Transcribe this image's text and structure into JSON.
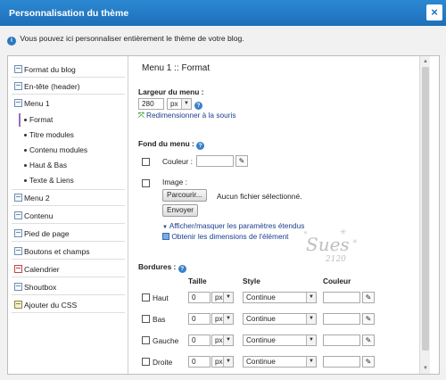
{
  "dialog": {
    "title": "Personnalisation du thème",
    "close_glyph": "×"
  },
  "info": {
    "icon": "info-icon",
    "text": "Vous pouvez ici personnaliser entièrement le thème de votre blog."
  },
  "sidebar": {
    "items": [
      {
        "label": "Format du blog",
        "icon": "page-icon"
      },
      {
        "label": "En-tête (header)",
        "icon": "page-icon"
      },
      {
        "label": "Menu 1",
        "icon": "page-icon"
      },
      {
        "label": "Menu 2",
        "icon": "page-icon"
      },
      {
        "label": "Contenu",
        "icon": "page-icon"
      },
      {
        "label": "Pied de page",
        "icon": "page-icon"
      },
      {
        "label": "Boutons et champs",
        "icon": "button-icon"
      },
      {
        "label": "Calendrier",
        "icon": "calendar-icon"
      },
      {
        "label": "Shoutbox",
        "icon": "chat-icon"
      },
      {
        "label": "Ajouter du CSS",
        "icon": "css-icon"
      }
    ],
    "subitems": [
      {
        "label": "Format",
        "active": true
      },
      {
        "label": "Titre modules"
      },
      {
        "label": "Contenu modules"
      },
      {
        "label": "Haut & Bas"
      },
      {
        "label": "Texte & Liens"
      }
    ]
  },
  "panel": {
    "heading": "Menu 1 :: Format",
    "width_label": "Largeur du menu :",
    "width_value": "280",
    "width_unit": "px",
    "resize_link": "Redimensionner à la souris",
    "fond_label": "Fond du menu :",
    "color_label": "Couleur :",
    "color_value": "",
    "image_label": "Image :",
    "browse_button": "Parcourir...",
    "no_file_text": "Aucun fichier sélectionné.",
    "send_button": "Envoyer",
    "toggle_params_link": "Afficher/masquer les paramètres étendus",
    "dimensions_link": "Obtenir les dimensions de l'élément",
    "borders_label": "Bordures :",
    "borders_columns": {
      "size": "Taille",
      "style": "Style",
      "color": "Couleur"
    },
    "borders": [
      {
        "label": "Haut",
        "size": "0",
        "unit": "px",
        "style": "Continue",
        "color": ""
      },
      {
        "label": "Bas",
        "size": "0",
        "unit": "px",
        "style": "Continue",
        "color": ""
      },
      {
        "label": "Gauche",
        "size": "0",
        "unit": "px",
        "style": "Continue",
        "color": ""
      },
      {
        "label": "Droite",
        "size": "0",
        "unit": "px",
        "style": "Continue",
        "color": ""
      }
    ]
  },
  "watermark": {
    "text": "Sues 2120"
  },
  "colors": {
    "titlebar": "#1d6fb9",
    "link": "#1a3d8f",
    "help": "#3a80c8",
    "active_marker": "#9b6eb7"
  }
}
